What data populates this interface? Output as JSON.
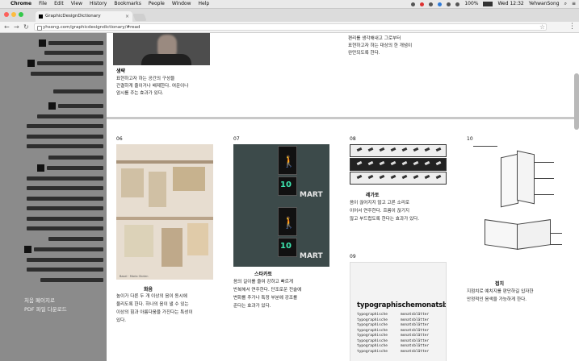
{
  "menubar": {
    "app": "Chrome",
    "items": [
      "File",
      "Edit",
      "View",
      "History",
      "Bookmarks",
      "People",
      "Window",
      "Help"
    ],
    "status": {
      "battery": "100%",
      "clock": "Wed 12:32",
      "user": "YehwanSong"
    }
  },
  "browser": {
    "tab_title": "GraphicDesignDictionary",
    "url": "yhsong.com/graphicdesigndictionary/#read"
  },
  "sidebar": {
    "links": [
      "처음 페이지로",
      "PDF 파일 다운로드"
    ]
  },
  "entries": {
    "top_left": {
      "title": "생략",
      "text": [
        "표현하고자 하는 공간의 구성을",
        "간결하게 줄이거나 배제한다. 여운이나",
        "암시를 주는 효과가 있다."
      ]
    },
    "top_right": {
      "text": [
        "편리를 생각해내고 그로부터",
        "표현하고자 하는 대상의 한 개념이",
        "완만되도록 한다."
      ]
    },
    "e06": {
      "num": "06",
      "title": "화음",
      "text": [
        "높이가 다른 두 개 이상의 음이 동시에",
        "울리도록 한다. 하나의 음이 낼 수 있는",
        "이상의 힘과 아름다움을 가진다는 특성이",
        "있다."
      ],
      "caption": "Basel · Maria Obrien"
    },
    "e07": {
      "num": "07",
      "title": "스타카토",
      "text": [
        "음의 길이를 줄여 강하고 빠르게",
        "반복해서 연주한다. 단조로운 전술에",
        "변화를 추가나 특정 부분에 강조를",
        "준다는 효과가 있다."
      ],
      "digits": "10",
      "sign": "MART"
    },
    "e08": {
      "num": "08",
      "title": "레가토",
      "text": [
        "음이 끊어지지 않고 고른 소리로",
        "이어서 연주한다. 흐름이 끊기지",
        "않고 부드럽도록 한다는 효과가 있다."
      ]
    },
    "e09": {
      "num": "09",
      "poster_title": "typographischemonatsblätter",
      "poster_cols": [
        [
          "typographische",
          "typographische",
          "typographische",
          "typographische",
          "typographische",
          "typographische",
          "typographische",
          "typographische"
        ],
        [
          "monatsblätter",
          "monatsblätter",
          "monatsblätter",
          "monatsblätter",
          "monatsblätter",
          "monatsblätter",
          "monatsblätter",
          "monatsblätter"
        ]
      ]
    },
    "e10": {
      "num": "10",
      "title": "접치",
      "text": [
        "지점치로 예치지를 판단하길 입자한",
        "안정적인 음색을 가능하게 한다."
      ]
    }
  }
}
